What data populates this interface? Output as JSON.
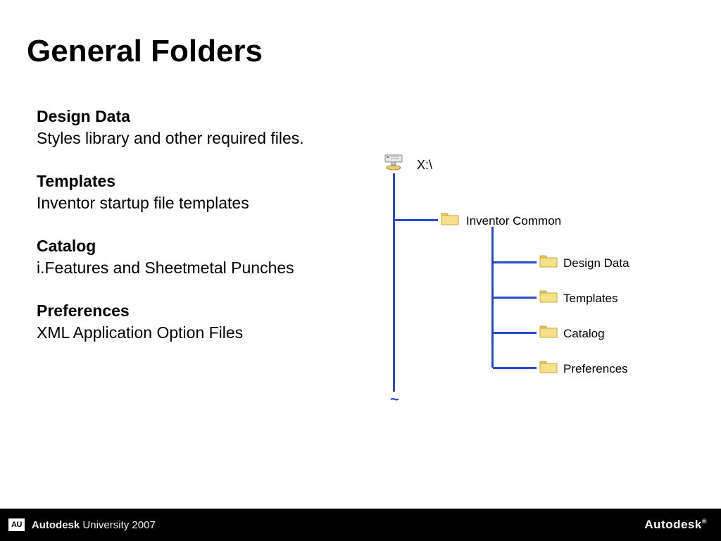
{
  "title": "General Folders",
  "sections": [
    {
      "heading": "Design Data",
      "desc": "Styles library and other required files."
    },
    {
      "heading": "Templates",
      "desc": "Inventor startup file templates"
    },
    {
      "heading": "Catalog",
      "desc": "i.Features and Sheetmetal Punches"
    },
    {
      "heading": "Preferences",
      "desc": "XML Application Option Files"
    }
  ],
  "diagram": {
    "drive": "X:\\",
    "root_folder": "Inventor Common",
    "subfolders": [
      "Design Data",
      "Templates",
      "Catalog",
      "Preferences"
    ]
  },
  "footer": {
    "badge": "AU",
    "left_bold": "Autodesk",
    "left_rest": " University 2007",
    "right": "Autodesk"
  }
}
